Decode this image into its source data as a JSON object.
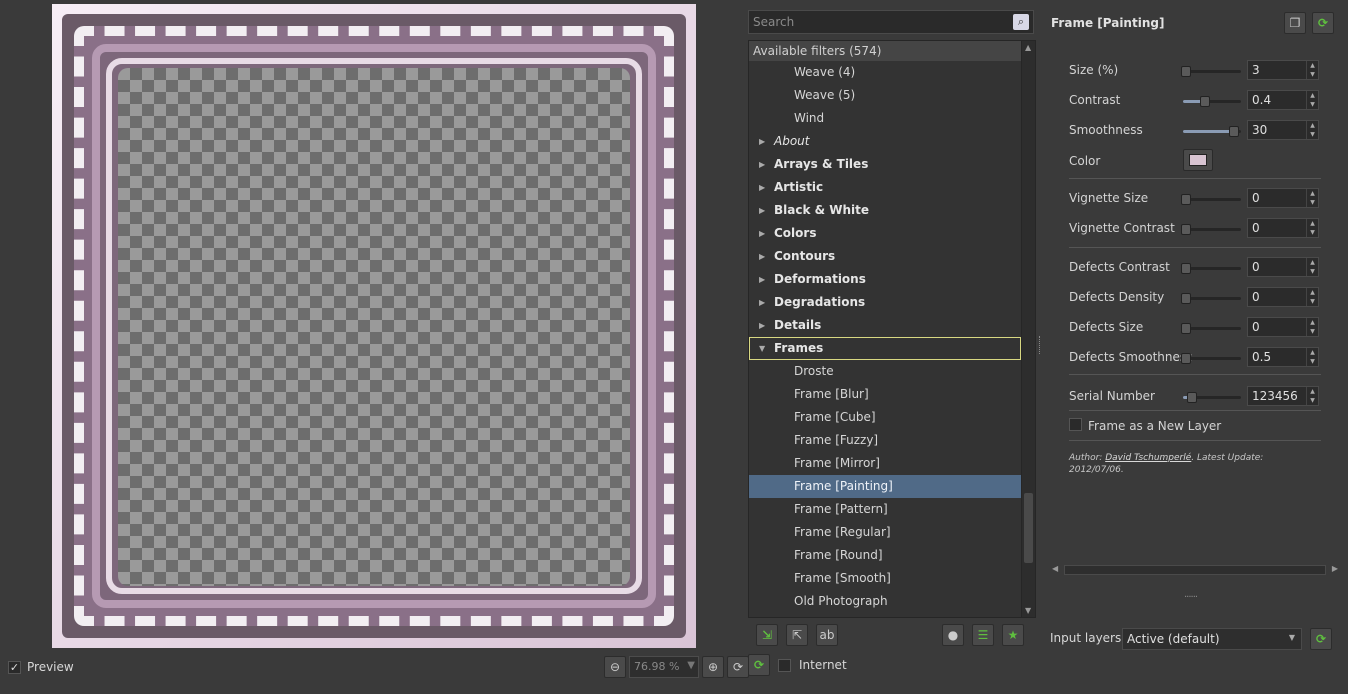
{
  "preview": {
    "checkbox_mark": "✓",
    "preview_label": "Preview",
    "zoom_value": "76.98 %"
  },
  "filters": {
    "search_placeholder": "Search",
    "header": "Available filters (574)",
    "tree": [
      {
        "label": "Weave (4)",
        "kind": "leaf"
      },
      {
        "label": "Weave (5)",
        "kind": "leaf"
      },
      {
        "label": "Wind",
        "kind": "leaf"
      },
      {
        "label": "About",
        "kind": "cat-italic"
      },
      {
        "label": "Arrays & Tiles",
        "kind": "cat"
      },
      {
        "label": "Artistic",
        "kind": "cat"
      },
      {
        "label": "Black & White",
        "kind": "cat"
      },
      {
        "label": "Colors",
        "kind": "cat"
      },
      {
        "label": "Contours",
        "kind": "cat"
      },
      {
        "label": "Deformations",
        "kind": "cat"
      },
      {
        "label": "Degradations",
        "kind": "cat"
      },
      {
        "label": "Details",
        "kind": "cat"
      },
      {
        "label": "Frames",
        "kind": "cat-open"
      },
      {
        "label": "Droste",
        "kind": "leaf"
      },
      {
        "label": "Frame [Blur]",
        "kind": "leaf"
      },
      {
        "label": "Frame [Cube]",
        "kind": "leaf"
      },
      {
        "label": "Frame [Fuzzy]",
        "kind": "leaf"
      },
      {
        "label": "Frame [Mirror]",
        "kind": "leaf"
      },
      {
        "label": "Frame [Painting]",
        "kind": "leaf-selected"
      },
      {
        "label": "Frame [Pattern]",
        "kind": "leaf"
      },
      {
        "label": "Frame [Regular]",
        "kind": "leaf"
      },
      {
        "label": "Frame [Round]",
        "kind": "leaf"
      },
      {
        "label": "Frame [Smooth]",
        "kind": "leaf"
      },
      {
        "label": "Old Photograph",
        "kind": "leaf"
      }
    ],
    "internet_label": "Internet"
  },
  "params": {
    "title": "Frame [Painting]",
    "rows": [
      {
        "label": "Size (%)",
        "value": "3",
        "pos": 0.0
      },
      {
        "label": "Contrast",
        "value": "0.4",
        "pos": 0.4
      },
      {
        "label": "Smoothness",
        "value": "30",
        "pos": 1.0
      },
      {
        "label": "Vignette Size",
        "value": "0",
        "pos": 0.0
      },
      {
        "label": "Vignette Contrast",
        "value": "0",
        "pos": 0.0
      },
      {
        "label": "Defects Contrast",
        "value": "0",
        "pos": 0.0
      },
      {
        "label": "Defects Density",
        "value": "0",
        "pos": 0.0
      },
      {
        "label": "Defects Size",
        "value": "0",
        "pos": 0.0
      },
      {
        "label": "Defects Smoothness",
        "value": "0.5",
        "pos": 0.0
      },
      {
        "label": "Serial Number",
        "value": "123456",
        "pos": 0.12
      }
    ],
    "color_label": "Color",
    "color_value": "#d8c4d2",
    "new_layer_label": "Frame as a New Layer",
    "author_prefix": "Author: ",
    "author_name": "David Tschumperlé",
    "author_suffix": ".     Latest Update: 2012/07/06.",
    "input_layers_label": "Input layers",
    "input_layers_value": "Active (default)"
  },
  "colors": {
    "selected": "#506a87",
    "focus_outline": "#d8d882",
    "accent_green": "#5fbf3f"
  }
}
